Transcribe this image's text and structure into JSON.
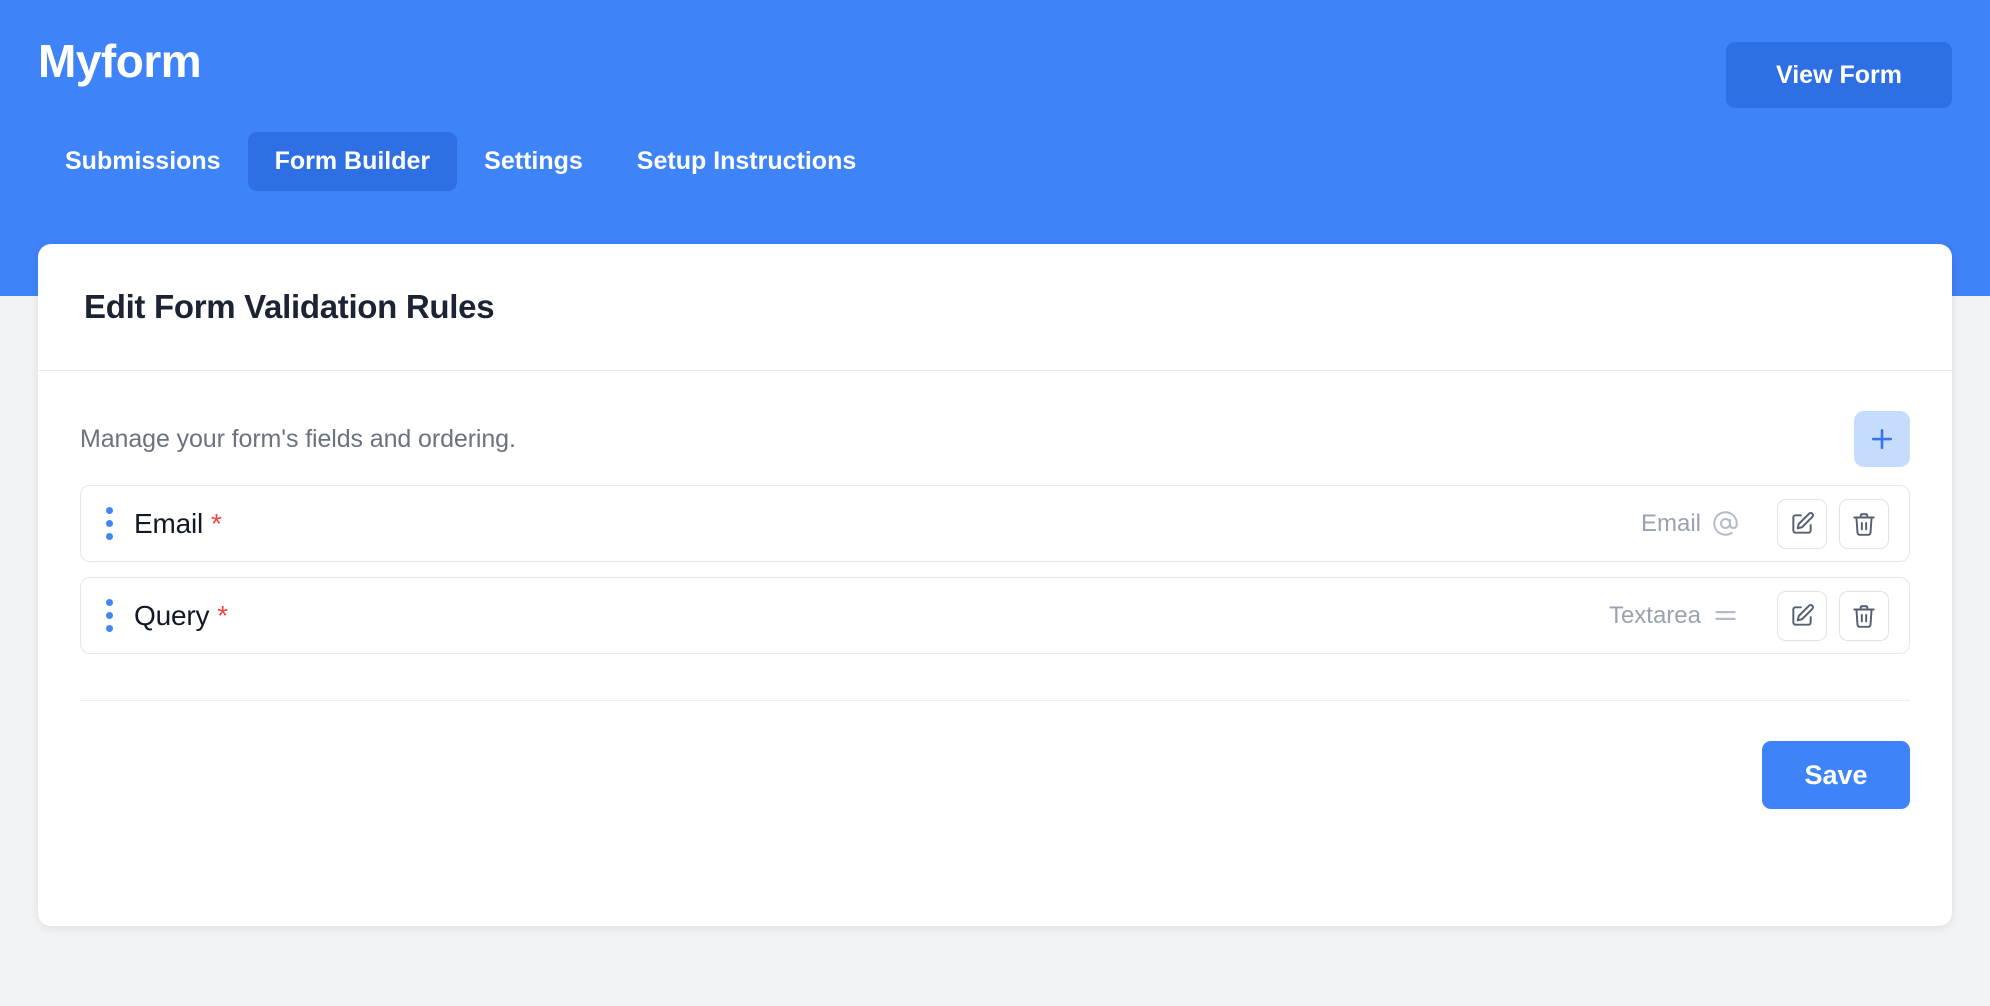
{
  "header": {
    "brand": "Myform",
    "view_form_label": "View Form",
    "accent_blue": "#3f83f8",
    "active_tab_blue": "#2f6fe4",
    "tabs": [
      {
        "label": "Submissions",
        "active": false
      },
      {
        "label": "Form Builder",
        "active": true
      },
      {
        "label": "Settings",
        "active": false
      },
      {
        "label": "Setup Instructions",
        "active": false
      }
    ]
  },
  "card": {
    "title": "Edit Form Validation Rules",
    "subtitle": "Manage your form's fields and ordering.",
    "add_button_icon": "plus-icon",
    "fields": [
      {
        "label": "Email",
        "required_marker": "*",
        "type_label": "Email",
        "type_icon": "at-sign-icon",
        "edit_icon": "edit-pencil-icon",
        "delete_icon": "trash-icon",
        "drag_icon": "drag-dots-icon"
      },
      {
        "label": "Query",
        "required_marker": "*",
        "type_label": "Textarea",
        "type_icon": "text-lines-icon",
        "edit_icon": "edit-pencil-icon",
        "delete_icon": "trash-icon",
        "drag_icon": "drag-dots-icon"
      }
    ],
    "save_label": "Save",
    "required_color": "#ef4444",
    "muted_text_color": "#9aa2b1"
  }
}
